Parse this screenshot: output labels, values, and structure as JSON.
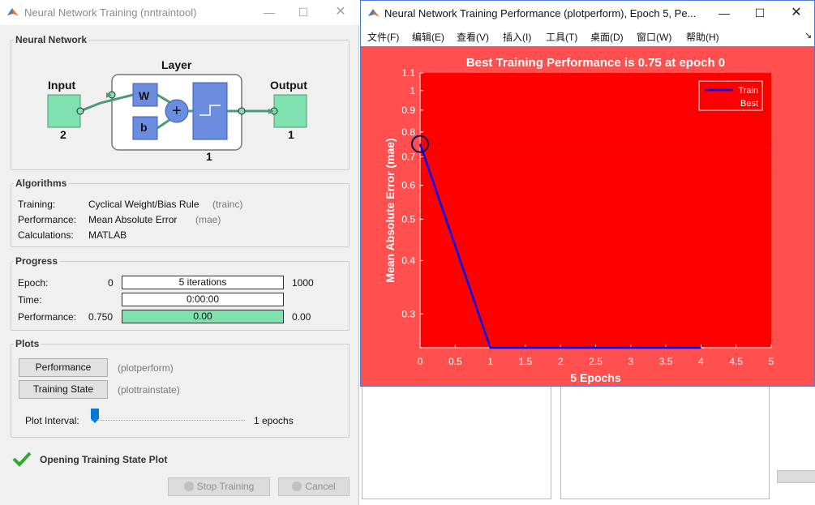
{
  "train_window": {
    "title": "Neural Network Training (nntraintool)",
    "network": {
      "group_title": "Neural Network",
      "input_label": "Input",
      "input_size": "2",
      "layer_label": "Layer",
      "layer_size": "1",
      "output_label": "Output",
      "output_size": "1",
      "weight_label": "W",
      "bias_label": "b",
      "sum_symbol": "+"
    },
    "algorithms": {
      "group_title": "Algorithms",
      "rows": [
        {
          "label": "Training:",
          "value": "Cyclical Weight/Bias Rule",
          "code": "(trainc)"
        },
        {
          "label": "Performance:",
          "value": "Mean Absolute Error",
          "code": "(mae)"
        },
        {
          "label": "Calculations:",
          "value": "MATLAB",
          "code": ""
        }
      ]
    },
    "progress": {
      "group_title": "Progress",
      "rows": [
        {
          "label": "Epoch:",
          "start": "0",
          "bar_text": "5 iterations",
          "end": "1000",
          "fill": 0
        },
        {
          "label": "Time:",
          "start": "",
          "bar_text": "0:00:00",
          "end": "",
          "fill": 0
        },
        {
          "label": "Performance:",
          "start": "0.750",
          "bar_text": "0.00",
          "end": "0.00",
          "fill": 1
        }
      ]
    },
    "plots": {
      "group_title": "Plots",
      "buttons": [
        {
          "label": "Performance",
          "fn": "(plotperform)"
        },
        {
          "label": "Training State",
          "fn": "(plottrainstate)"
        }
      ],
      "interval_label": "Plot Interval:",
      "interval_value": "1 epochs",
      "interval_fraction": 0
    },
    "status_text": "Opening Training State Plot",
    "stop_label": "Stop Training",
    "cancel_label": "Cancel"
  },
  "perf_window": {
    "title": "Neural Network Training Performance (plotperform), Epoch 5, Pe...",
    "menu": [
      "文件(F)",
      "编辑(E)",
      "查看(V)",
      "插入(I)",
      "工具(T)",
      "桌面(D)",
      "窗口(W)",
      "帮助(H)"
    ]
  },
  "colors": {
    "figure_bg": "#ff4f4f",
    "axes_bg": "#ff0000",
    "train_line": "#0000ff",
    "best_marker": "#0a0a60",
    "tool_fill": "#7fe0b0"
  },
  "chart_data": {
    "type": "line",
    "title": "Best Training Performance is 0.75 at epoch 0",
    "xlabel": "5 Epochs",
    "ylabel": "Mean Absolute Error  (mae)",
    "xlim": [
      0,
      5
    ],
    "ylim": [
      0.25,
      1.1
    ],
    "yscale": "log",
    "xticks": [
      "0",
      "0.5",
      "1",
      "1.5",
      "2",
      "2.5",
      "3",
      "3.5",
      "4",
      "4.5",
      "5"
    ],
    "yticks": [
      "0.3",
      "0.4",
      "0.5",
      "0.6",
      "0.7",
      "0.8",
      "0.9",
      "1",
      "1.1"
    ],
    "grid": false,
    "legend_position": "top-right",
    "series": [
      {
        "name": "Train",
        "x": [
          0,
          1,
          2,
          3,
          4
        ],
        "y": [
          0.75,
          0.25,
          0.25,
          0.25,
          0.25
        ]
      }
    ],
    "best": {
      "name": "Best",
      "x": 0,
      "y": 0.75
    }
  }
}
